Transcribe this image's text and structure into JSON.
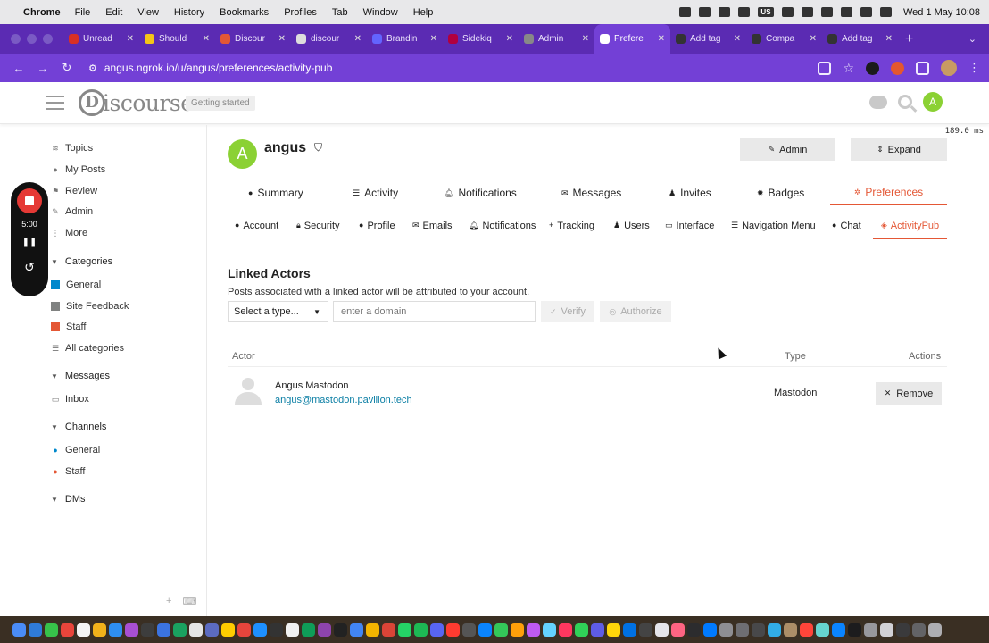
{
  "menubar": {
    "app": "Chrome",
    "items": [
      "File",
      "Edit",
      "View",
      "History",
      "Bookmarks",
      "Profiles",
      "Tab",
      "Window",
      "Help"
    ],
    "input_source": "US",
    "clock": "Wed 1 May  10:08"
  },
  "tabs": [
    {
      "label": "Unread",
      "color": "#d93025"
    },
    {
      "label": "Should",
      "color": "#f5c518"
    },
    {
      "label": "Discour",
      "color": "#e45735"
    },
    {
      "label": "discour",
      "color": "#dddddd"
    },
    {
      "label": "Brandin",
      "color": "#6364ff"
    },
    {
      "label": "Sidekiq",
      "color": "#b1003e"
    },
    {
      "label": "Admin",
      "color": "#888888"
    },
    {
      "label": "Prefere",
      "color": "#ffffff",
      "active": true
    },
    {
      "label": "Add tag",
      "color": "#333333"
    },
    {
      "label": "Compa",
      "color": "#333333"
    },
    {
      "label": "Add tag",
      "color": "#333333"
    }
  ],
  "url": "angus.ngrok.io/u/angus/preferences/activity-pub",
  "header": {
    "logo_text": "iscourse",
    "logo_letter": "D",
    "getting_started": "Getting started",
    "avatar_letter": "A",
    "perf": "189.0 ms"
  },
  "recorder": {
    "time": "5:00"
  },
  "sidebar": {
    "top": [
      "Topics",
      "My Posts",
      "Review",
      "Admin",
      "More"
    ],
    "categories_title": "Categories",
    "categories": [
      {
        "label": "General",
        "color": "#0088cc"
      },
      {
        "label": "Site Feedback",
        "color": "#808281"
      },
      {
        "label": "Staff",
        "color": "#e45735"
      },
      {
        "label": "All categories",
        "color": ""
      }
    ],
    "messages_title": "Messages",
    "messages": [
      "Inbox"
    ],
    "channels_title": "Channels",
    "channels": [
      "General",
      "Staff"
    ],
    "dms_title": "DMs"
  },
  "user": {
    "avatar_letter": "A",
    "name": "angus",
    "admin_label": "Admin",
    "expand_label": "Expand"
  },
  "main_nav": [
    "Summary",
    "Activity",
    "Notifications",
    "Messages",
    "Invites",
    "Badges",
    "Preferences"
  ],
  "sub_nav": [
    "Account",
    "Security",
    "Profile",
    "Emails",
    "Notifications",
    "Tracking",
    "Users",
    "Interface",
    "Navigation Menu",
    "Chat",
    "ActivityPub"
  ],
  "linked_actors": {
    "title": "Linked Actors",
    "description": "Posts associated with a linked actor will be attributed to your account.",
    "select_placeholder": "Select a type...",
    "domain_placeholder": "enter a domain",
    "verify_label": "Verify",
    "authorize_label": "Authorize",
    "columns": {
      "actor": "Actor",
      "type": "Type",
      "actions": "Actions"
    },
    "rows": [
      {
        "name": "Angus Mastodon",
        "handle": "angus@mastodon.pavilion.tech",
        "type": "Mastodon",
        "action": "Remove"
      }
    ]
  },
  "colors": {
    "accent": "#e45735",
    "link": "#0a7ea4",
    "chrome": "#7340d6",
    "avatar": "#8bd134"
  }
}
